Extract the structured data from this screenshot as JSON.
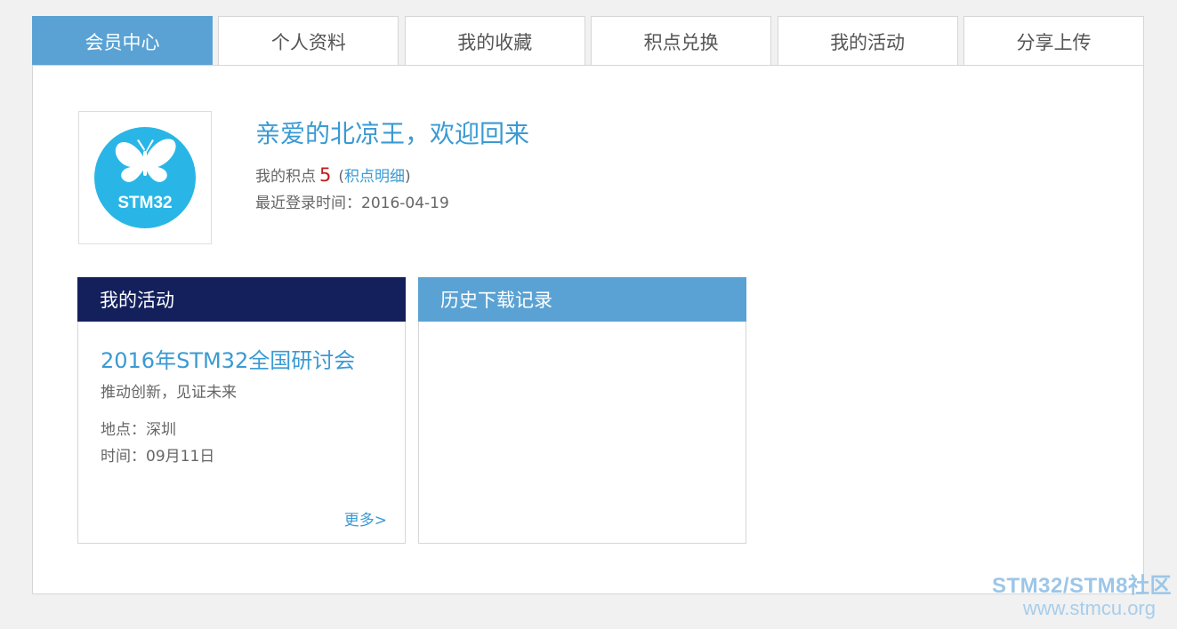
{
  "tabs": [
    {
      "label": "会员中心",
      "active": true
    },
    {
      "label": "个人资料",
      "active": false
    },
    {
      "label": "我的收藏",
      "active": false
    },
    {
      "label": "积点兑换",
      "active": false
    },
    {
      "label": "我的活动",
      "active": false
    },
    {
      "label": "分享上传",
      "active": false
    }
  ],
  "profile": {
    "avatar_icon": "butterfly-icon",
    "avatar_text": "STM32",
    "welcome": "亲爱的北凉王，欢迎回来",
    "points_label": "我的积点",
    "points_value": "5",
    "points_link_open": "(",
    "points_link": "积点明细",
    "points_link_close": ")",
    "last_login": "最近登录时间：2016-04-19"
  },
  "activity_card": {
    "header": "我的活动",
    "event_title": "2016年STM32全国研讨会",
    "event_subtitle": "推动创新，见证未来",
    "location": "地点：深圳",
    "time": "时间：09月11日",
    "more": "更多>"
  },
  "download_card": {
    "header": "历史下载记录"
  },
  "watermark": {
    "title": "STM32/STM8社区",
    "url": "www.stmcu.org"
  },
  "colors": {
    "accent": "#5aa2d4",
    "link": "#3a9ad3",
    "activity_header": "#13205c",
    "points": "#c31a1a",
    "avatar": "#29b6e6"
  }
}
